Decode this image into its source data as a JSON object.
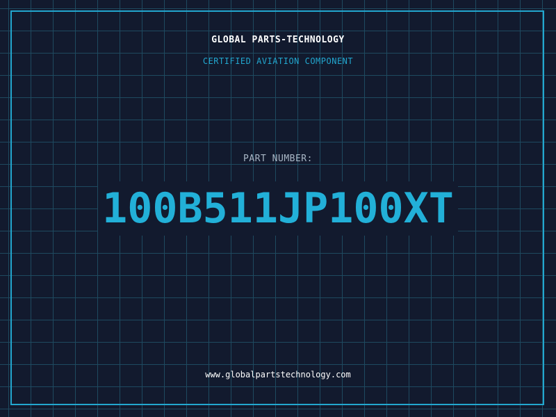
{
  "header": {
    "company": "GLOBAL PARTS-TECHNOLOGY",
    "subtitle": "CERTIFIED AVIATION COMPONENT"
  },
  "part": {
    "label": "PART NUMBER:",
    "number": "100B511JP100XT"
  },
  "footer": {
    "website": "www.globalpartstechnology.com"
  },
  "colors": {
    "background": "#121a2e",
    "accent": "#22a7cf",
    "grid": "#1e4a60",
    "label": "#a9b7c6",
    "text": "#ffffff"
  }
}
